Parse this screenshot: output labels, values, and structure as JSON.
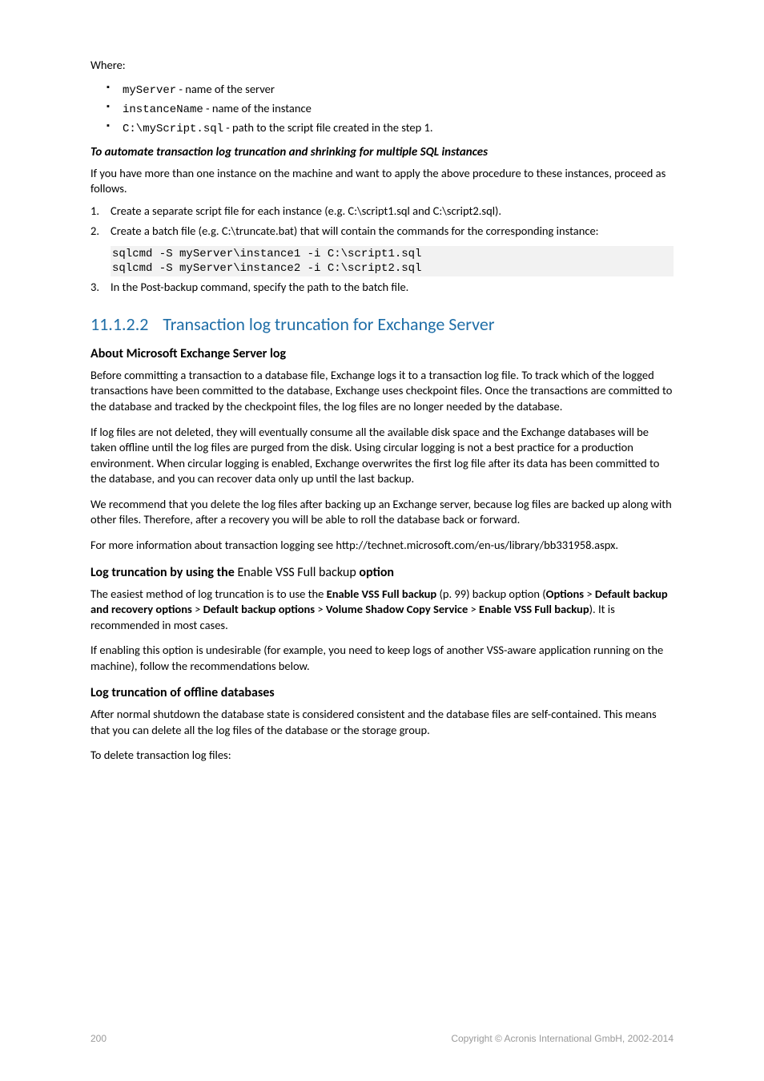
{
  "intro": {
    "where": "Where:",
    "bullets": [
      {
        "code": "myServer",
        "text": " - name of the server"
      },
      {
        "code": "instanceName",
        "text": " - name of the instance"
      },
      {
        "code": "C:\\myScript.sql",
        "text": " - path to the script file created in the step 1."
      }
    ]
  },
  "section_multi": {
    "heading": "To automate transaction log truncation and shrinking for multiple SQL instances",
    "p1": "If you have more than one instance on the machine and want to apply the above procedure to these instances, proceed as follows.",
    "li1": "Create a separate script file for each instance (e.g. C:\\script1.sql and C:\\script2.sql).",
    "li2": "Create a batch file (e.g. C:\\truncate.bat) that will contain the commands for the corresponding instance:",
    "code": "sqlcmd -S myServer\\instance1 -i C:\\script1.sql\nsqlcmd -S myServer\\instance2 -i C:\\script2.sql",
    "li3": "In the Post-backup command, specify the path to the batch file."
  },
  "h2": {
    "num": "11.1.2.2",
    "title": "Transaction log truncation for Exchange Server"
  },
  "about": {
    "heading": "About Microsoft Exchange Server log",
    "p1": "Before committing a transaction to a database file, Exchange logs it to a transaction log file. To track which of the logged transactions have been committed to the database, Exchange uses checkpoint files. Once the transactions are committed to the database and tracked by the checkpoint files, the log files are no longer needed by the database.",
    "p2": "If log files are not deleted, they will eventually consume all the available disk space and the Exchange databases will be taken offline until the log files are purged from the disk. Using circular logging is not a best practice for a production environment. When circular logging is enabled, Exchange overwrites the first log file after its data has been committed to the database, and you can recover data only up until the last backup.",
    "p3": "We recommend that you delete the log files after backing up an Exchange server, because log files are backed up along with other files. Therefore, after a recovery you will be able to roll the database back or forward.",
    "p4": "For more information about transaction logging see http://technet.microsoft.com/en-us/library/bb331958.aspx."
  },
  "vss": {
    "heading_a": "Log truncation by using the ",
    "heading_b": "Enable VSS Full backup",
    "heading_c": " option",
    "p1_a": "The easiest method of log truncation is to use the ",
    "p1_b": "Enable VSS Full backup",
    "p1_c": " (p. 99) backup option (",
    "p1_d": "Options",
    "p1_e": " > ",
    "p1_f": "Default backup and recovery options",
    "p1_g": " > ",
    "p1_h": "Default backup options",
    "p1_i": " > ",
    "p1_j": "Volume Shadow Copy Service",
    "p1_k": " > ",
    "p1_l": "Enable VSS Full backup",
    "p1_m": "). It is recommended in most cases.",
    "p2": "If enabling this option is undesirable (for example, you need to keep logs of another VSS-aware application running on the machine), follow the recommendations below."
  },
  "offline": {
    "heading": "Log truncation of offline databases",
    "p1": "After normal shutdown the database state is considered consistent and the database files are self-contained. This means that you can delete all the log files of the database or the storage group.",
    "p2": "To delete transaction log files:"
  },
  "footer": {
    "page": "200",
    "copyright": "Copyright © Acronis International GmbH, 2002-2014"
  }
}
